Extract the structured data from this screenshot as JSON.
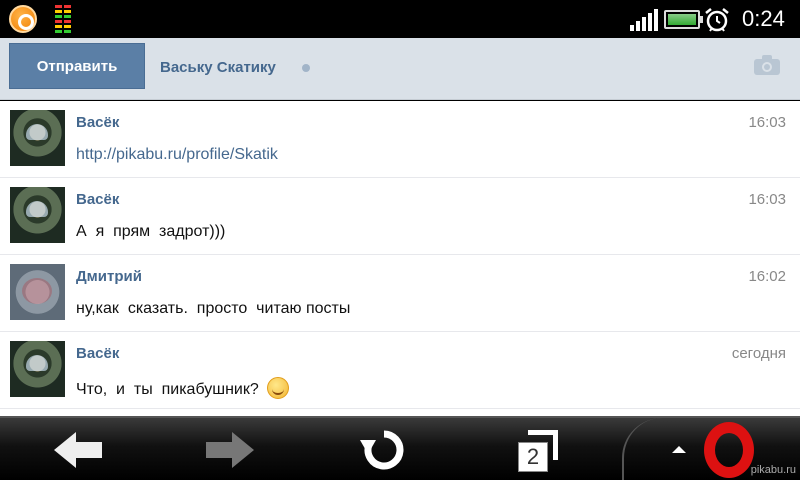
{
  "status_bar": {
    "clock": "0:24",
    "icons": [
      "app-icon",
      "level-meter-icon",
      "signal-icon",
      "battery-icon",
      "alarm-icon"
    ]
  },
  "header": {
    "send_label": "Отправить",
    "recipient": "Ваську Скатику"
  },
  "messages": [
    {
      "author": "Васёк",
      "time": "16:03",
      "text": "http://pikabu.ru/profile/Skatik",
      "is_link": true,
      "avatar": "vasek"
    },
    {
      "author": "Васёк",
      "time": "16:03",
      "text": "А  я  прям  задрот)))",
      "is_link": false,
      "avatar": "vasek"
    },
    {
      "author": "Дмитрий",
      "time": "16:02",
      "text": "ну,как  сказать.  просто  читаю посты",
      "is_link": false,
      "avatar": "dmitry"
    },
    {
      "author": "Васёк",
      "time": "сегодня",
      "text": "Что,  и  ты  пикабушник?",
      "is_link": false,
      "avatar": "vasek",
      "emoji": "smiley-icon"
    }
  ],
  "bottom_bar": {
    "tabs_count": "2",
    "icons": [
      "back-arrow-icon",
      "forward-arrow-icon",
      "reload-icon",
      "tabs-icon",
      "menu-up-icon",
      "opera-icon"
    ]
  },
  "watermark": "pikabu.ru",
  "colors": {
    "accent": "#5b7fa6",
    "link": "#45688e",
    "header_bg": "#dae1e8"
  }
}
